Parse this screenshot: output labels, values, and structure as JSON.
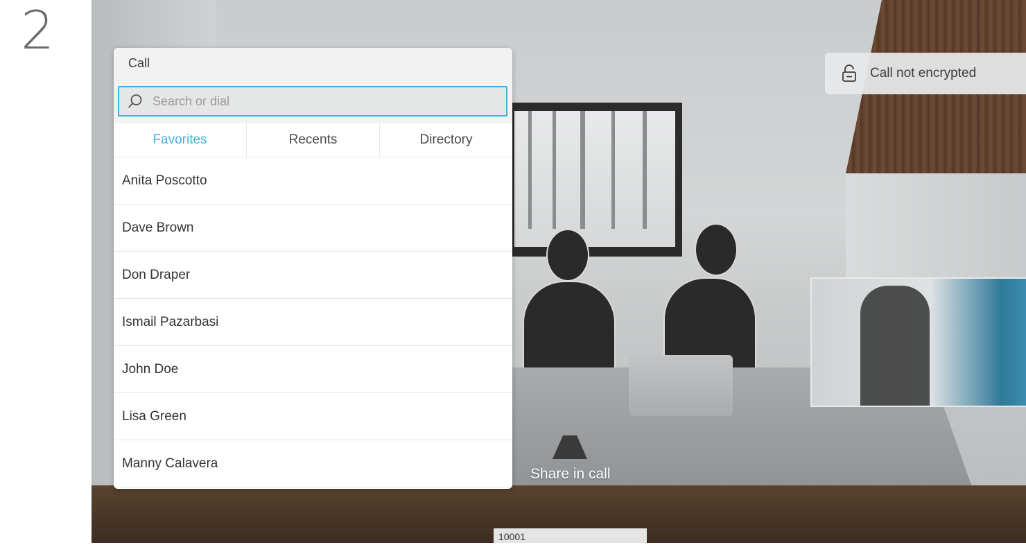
{
  "step_number": "2",
  "call_panel": {
    "title": "Call",
    "search_placeholder": "Search or dial",
    "tabs": [
      {
        "label": "Favorites",
        "active": true
      },
      {
        "label": "Recents",
        "active": false
      },
      {
        "label": "Directory",
        "active": false
      }
    ],
    "contacts": [
      "Anita Poscotto",
      "Dave Brown",
      "Don Draper",
      "Ismail Pazarbasi",
      "John Doe",
      "Lisa Green",
      "Manny Calavera"
    ]
  },
  "encryption_status": {
    "text": "Call not encrypted",
    "icon": "unlocked-icon"
  },
  "share_label": "Share in call",
  "extension_number": "10001",
  "colors": {
    "accent": "#3fb2da",
    "panel_header": "#f2f2f2"
  }
}
